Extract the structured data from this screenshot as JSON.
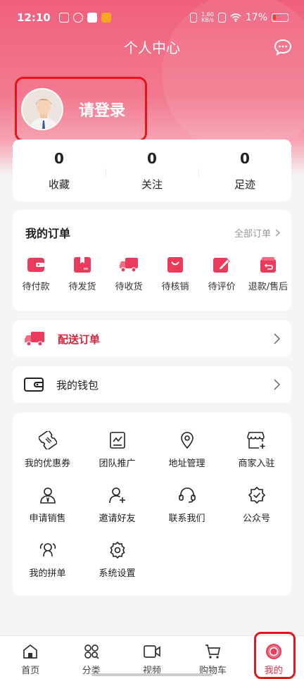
{
  "status_bar": {
    "time": "12:10",
    "network_speed": "1.60",
    "network_unit": "KB/s",
    "battery_percent": "17%"
  },
  "header": {
    "title": "个人中心",
    "login_prompt": "请登录"
  },
  "stats": [
    {
      "value": "0",
      "label": "收藏"
    },
    {
      "value": "0",
      "label": "关注"
    },
    {
      "value": "0",
      "label": "足迹"
    }
  ],
  "orders": {
    "title": "我的订单",
    "all_link": "全部订单",
    "items": [
      {
        "label": "待付款",
        "icon": "wallet-card-icon"
      },
      {
        "label": "待发货",
        "icon": "package-icon"
      },
      {
        "label": "待收货",
        "icon": "truck-icon"
      },
      {
        "label": "待核销",
        "icon": "shopping-bag-icon"
      },
      {
        "label": "待评价",
        "icon": "edit-icon"
      },
      {
        "label": "退款/售后",
        "icon": "return-box-icon"
      }
    ]
  },
  "delivery": {
    "label": "配送订单"
  },
  "wallet": {
    "label": "我的钱包"
  },
  "services": [
    {
      "label": "我的优惠券",
      "icon": "coupon-icon"
    },
    {
      "label": "团队推广",
      "icon": "chart-icon"
    },
    {
      "label": "地址管理",
      "icon": "location-pin-icon"
    },
    {
      "label": "商家入驻",
      "icon": "store-add-icon"
    },
    {
      "label": "申请销售",
      "icon": "salesperson-icon"
    },
    {
      "label": "邀请好友",
      "icon": "user-add-icon"
    },
    {
      "label": "联系我们",
      "icon": "headset-icon"
    },
    {
      "label": "公众号",
      "icon": "verified-badge-icon"
    },
    {
      "label": "我的拼单",
      "icon": "group-icon"
    },
    {
      "label": "系统设置",
      "icon": "gear-icon"
    }
  ],
  "tabbar": [
    {
      "label": "首页",
      "icon": "home-icon"
    },
    {
      "label": "分类",
      "icon": "category-icon"
    },
    {
      "label": "视频",
      "icon": "video-icon"
    },
    {
      "label": "购物车",
      "icon": "cart-icon"
    },
    {
      "label": "我的",
      "icon": "profile-icon",
      "active": true
    }
  ],
  "colors": {
    "brand": "#f0607c",
    "accent": "#e5304a",
    "highlight_border": "#e5151f"
  }
}
